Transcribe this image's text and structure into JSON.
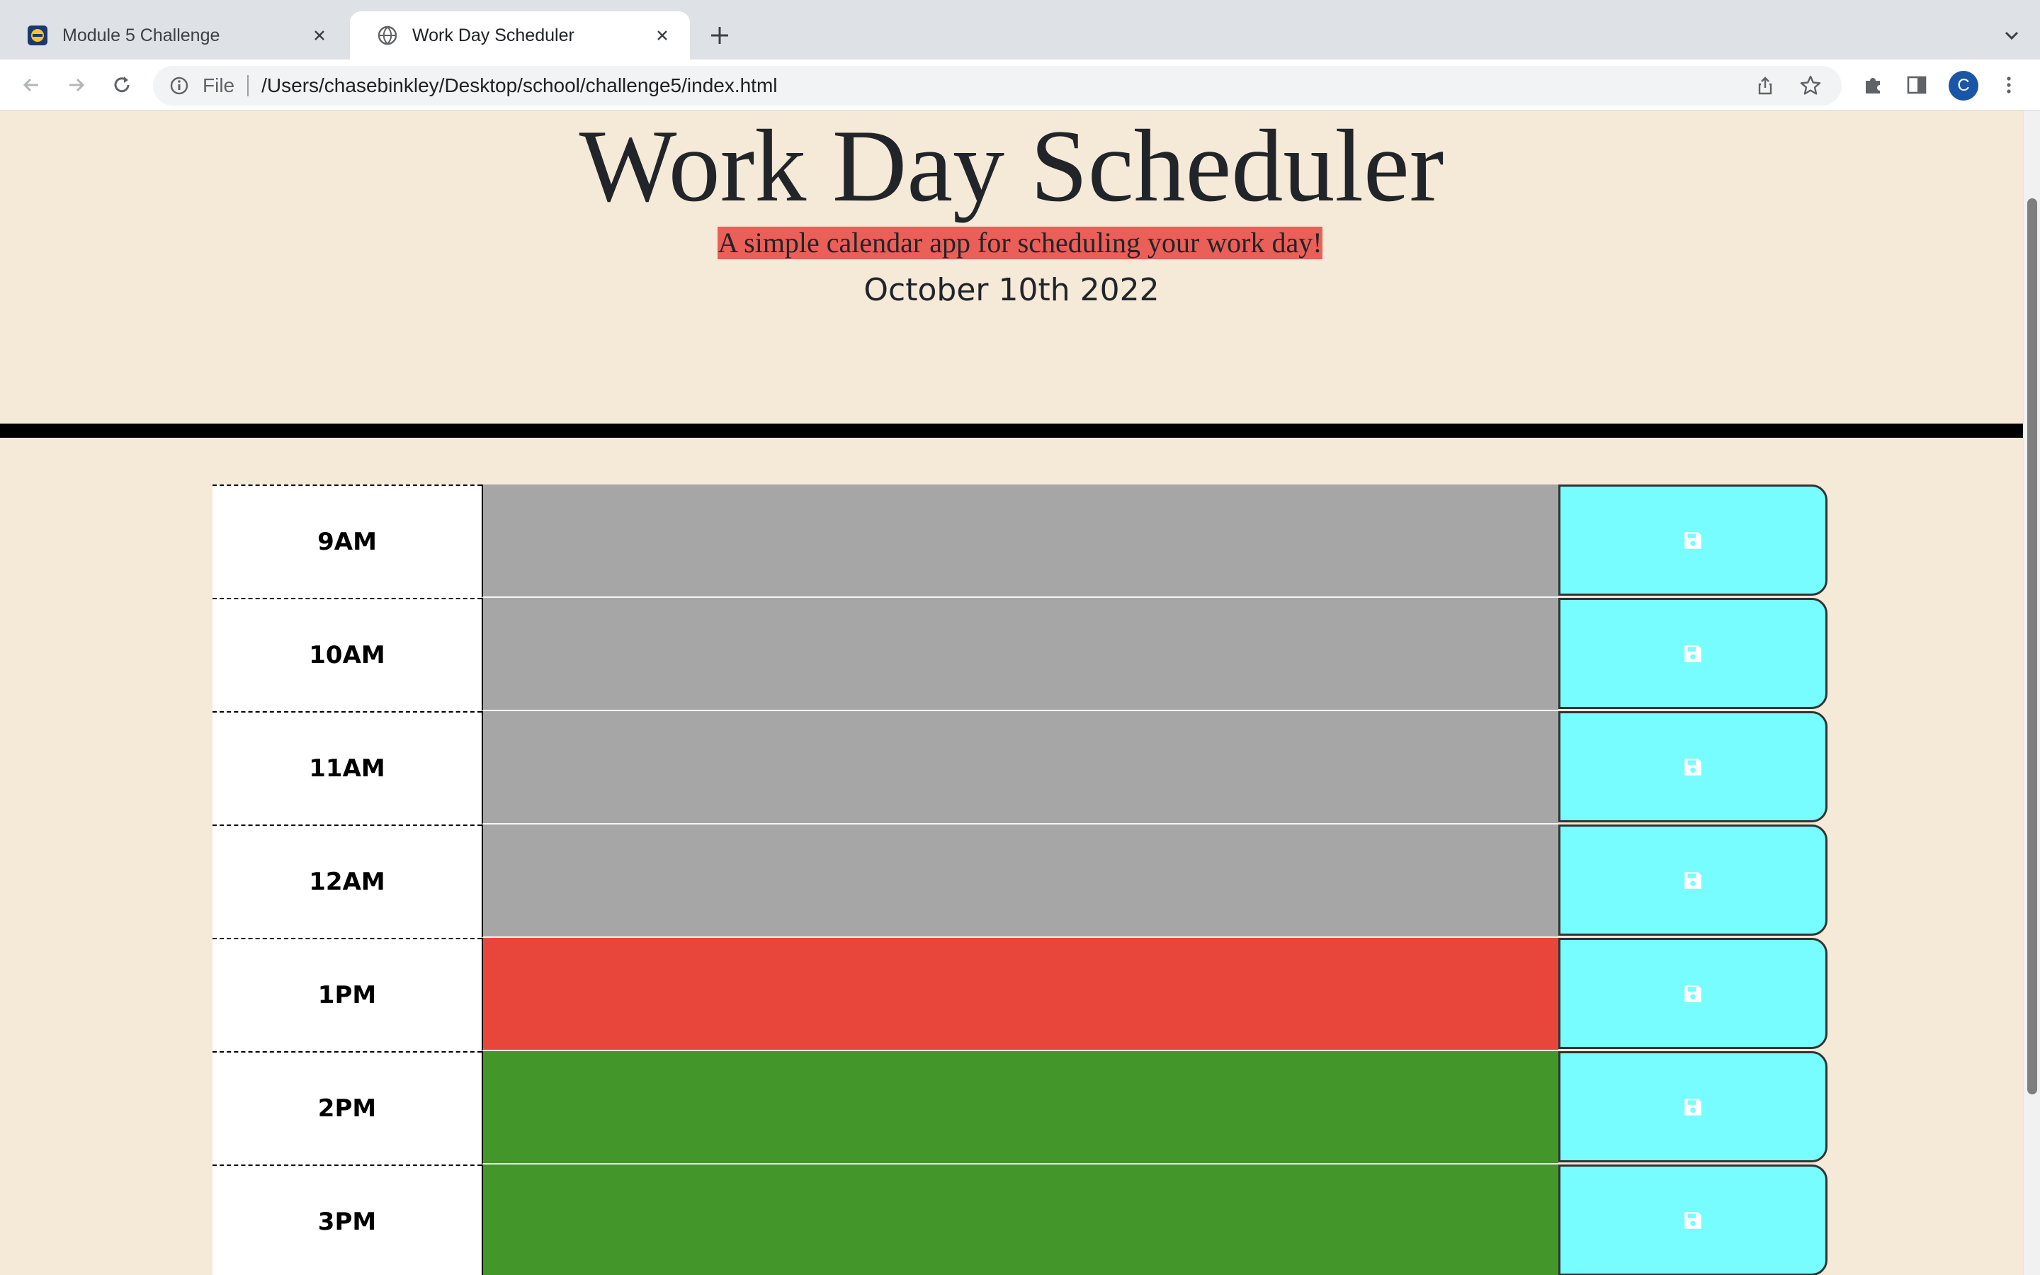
{
  "browser": {
    "tabs": [
      {
        "title": "Module 5 Challenge",
        "active": false
      },
      {
        "title": "Work Day Scheduler",
        "active": true
      }
    ],
    "address_scheme": "File",
    "address_url": "/Users/chasebinkley/Desktop/school/challenge5/index.html",
    "profile_initial": "C"
  },
  "page": {
    "title": "Work Day Scheduler",
    "lead": "A simple calendar app for scheduling your work day!",
    "current_day": "October 10th 2022"
  },
  "time_blocks": [
    {
      "hour": "9AM",
      "state": "past"
    },
    {
      "hour": "10AM",
      "state": "past"
    },
    {
      "hour": "11AM",
      "state": "past"
    },
    {
      "hour": "12AM",
      "state": "past"
    },
    {
      "hour": "1PM",
      "state": "present"
    },
    {
      "hour": "2PM",
      "state": "future"
    },
    {
      "hour": "3PM",
      "state": "future"
    }
  ],
  "colors": {
    "past": "#a6a6a6",
    "present": "#e8463b",
    "future": "#43962a",
    "save_button": "#77fcff",
    "lead_highlight": "#ea5f57",
    "page_background": "#f5e9d8"
  },
  "icons": {
    "save": "floppy-disk-icon"
  }
}
